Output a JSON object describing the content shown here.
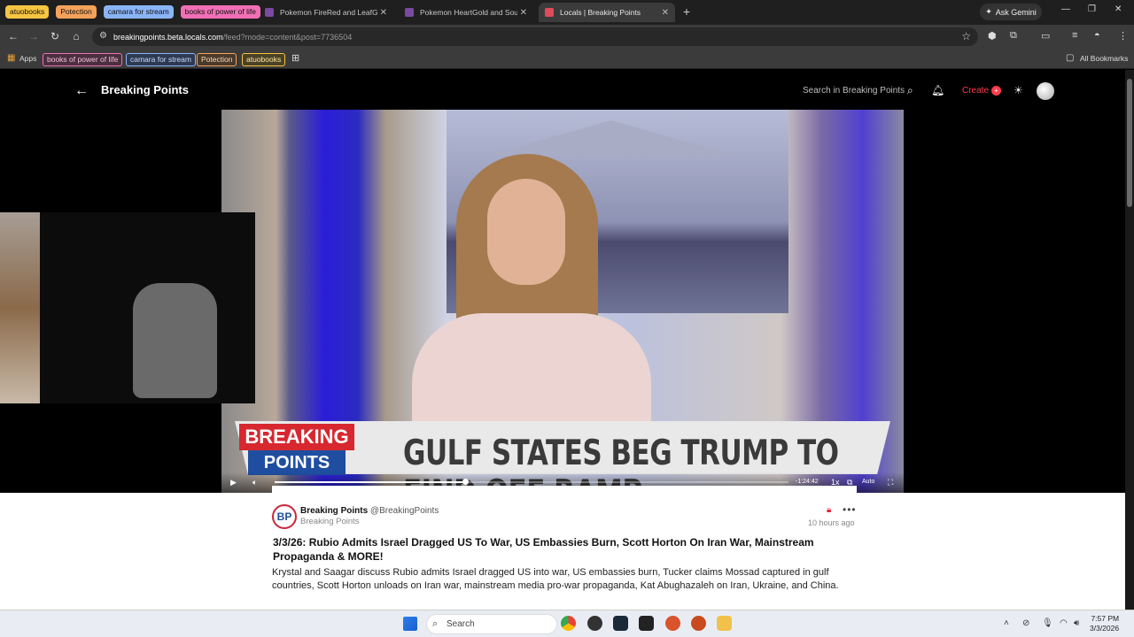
{
  "browser": {
    "tab_groups": [
      {
        "label": "atuobooks",
        "color": "#f5c542"
      },
      {
        "label": "Potection",
        "color": "#f5a25a"
      },
      {
        "label": "camara for stream",
        "color": "#8ab4f8"
      },
      {
        "label": "books of power of life",
        "color": "#f06fb5"
      }
    ],
    "tabs": [
      {
        "label": "Pokemon FireRed and LeafGre...",
        "active": false
      },
      {
        "label": "Pokemon HeartGold and SoulS...",
        "active": false
      },
      {
        "label": "Locals | Breaking Points",
        "active": true
      }
    ],
    "ask_gemini": "Ask Gemini",
    "url_host": "breakingpoints.beta.locals.com",
    "url_path": "/feed?mode=content&post=7736504",
    "bookmarks": {
      "apps": "Apps",
      "items": [
        {
          "label": "books of power of life",
          "color": "#f06fb5"
        },
        {
          "label": "camara for stream",
          "color": "#8ab4f8"
        },
        {
          "label": "Potection",
          "color": "#f5a25a"
        },
        {
          "label": "atuobooks",
          "color": "#f5c542"
        }
      ],
      "all_bookmarks": "All Bookmarks"
    }
  },
  "site": {
    "title": "Breaking Points",
    "search_placeholder": "Search in Breaking Points",
    "create": "Create",
    "create_badge": "+"
  },
  "video": {
    "lower_third_top": "BREAKING",
    "lower_third_bottom": "POINTS",
    "headline": "GULF STATES BEG TRUMP TO FIND OFF RAMP",
    "time_remaining": "-1:24:42",
    "speed": "1x",
    "quality": "Auto",
    "progress": 0.37
  },
  "post": {
    "avatar_text": "BP",
    "author": "Breaking Points",
    "handle": "@BreakingPoints",
    "community": "Breaking Points",
    "time": "10 hours ago",
    "title": "3/3/26: Rubio Admits Israel Dragged US To War, US Embassies Burn, Scott Horton On Iran War, Mainstream Propaganda & MORE!",
    "body": "Krystal and Saagar discuss Rubio admits Israel dragged US into war, US embassies burn, Tucker claims Mossad captured in gulf countries, Scott Horton unloads on Iran war, mainstream media pro-war propaganda, Kat Abughazaleh on Iran, Ukraine, and China."
  },
  "taskbar": {
    "search": "Search",
    "time": "7:57 PM",
    "date": "3/3/2026"
  }
}
